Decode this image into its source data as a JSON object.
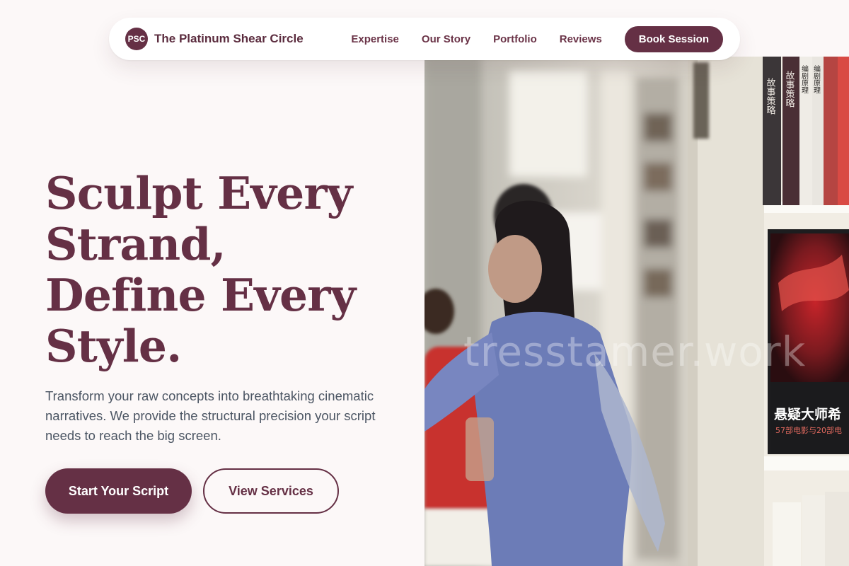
{
  "brand": {
    "logo_text": "PSC",
    "name": "The Platinum Shear Circle"
  },
  "nav": {
    "links": [
      "Expertise",
      "Our Story",
      "Portfolio",
      "Reviews"
    ],
    "cta_label": "Book Session"
  },
  "hero": {
    "headline_lines": [
      "Sculpt Every",
      "Strand,",
      "Define Every",
      "Style."
    ],
    "description": "Transform your raw concepts into breathtaking cinematic narratives. We provide the structural precision your script needs to reach the big screen.",
    "primary_button": "Start Your Script",
    "secondary_button": "View Services"
  },
  "photo": {
    "watermark": "tresstamer.work",
    "book_spines": [
      "故事策略",
      "故事策略",
      "编剧原理",
      "编剧原理"
    ],
    "poster_title": "悬疑大师希",
    "poster_subtitle": "57部电影与20部电"
  },
  "colors": {
    "brand": "#653045",
    "background": "#fcf8f8",
    "body_text": "#4b5563"
  }
}
